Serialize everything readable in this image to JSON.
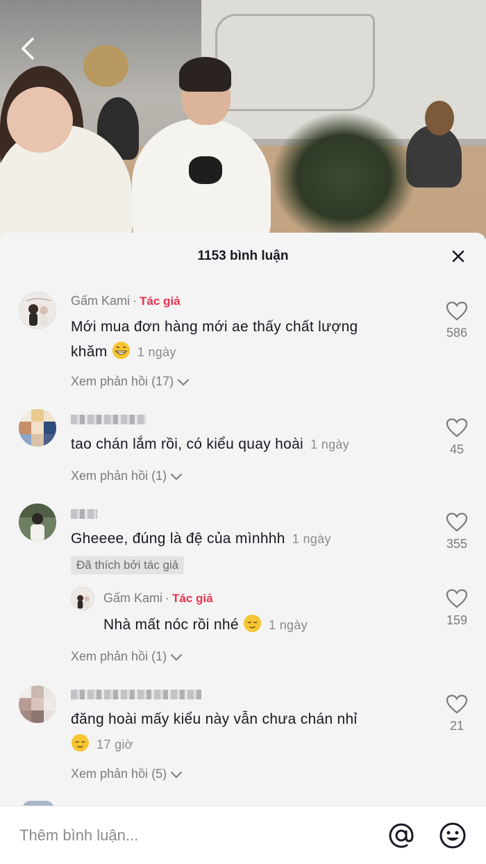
{
  "header": {
    "comment_count_title": "1153 bình luận"
  },
  "comments": [
    {
      "username": "Gấm Kami",
      "author_dot": "·",
      "author_tag": "Tác giả",
      "text": "Mới mua đơn hàng mới ae thấy chất lượng",
      "text_line2": "khăm",
      "time": "1 ngày",
      "likes": "586",
      "replies": "Xem phản hồi (17)"
    },
    {
      "username": "",
      "text": "tao chán lắm rồi, có kiểu quay hoài",
      "time": "1 ngày",
      "likes": "45",
      "replies": "Xem phản hồi (1)"
    },
    {
      "username": "",
      "text": "Gheeee, đúng là đệ của mìnhhh",
      "time": "1 ngày",
      "likes": "355",
      "liked_by_author": "Đã thích bởi tác giả",
      "reply": {
        "username": "Gấm Kami",
        "author_dot": "·",
        "author_tag": "Tác giả",
        "text": "Nhà mất nóc rồi nhé",
        "time": "1 ngày",
        "likes": "159"
      },
      "replies": "Xem phản hồi (1)"
    },
    {
      "username": "",
      "text": "đăng hoài mấy kiểu này vẫn chưa chán nhỉ",
      "time": "17 giờ",
      "likes": "21",
      "replies": "Xem phản hồi (5)"
    }
  ],
  "input": {
    "placeholder": "Thêm bình luận..."
  },
  "colors": {
    "author_tag": "#e8344f",
    "text": "#161823",
    "muted": "#7a7a80",
    "sheet_bg": "#f4f4f4"
  },
  "icons": [
    "back-icon",
    "close-icon",
    "heart-icon",
    "chevron-down-icon",
    "at-icon",
    "emoji-icon"
  ]
}
